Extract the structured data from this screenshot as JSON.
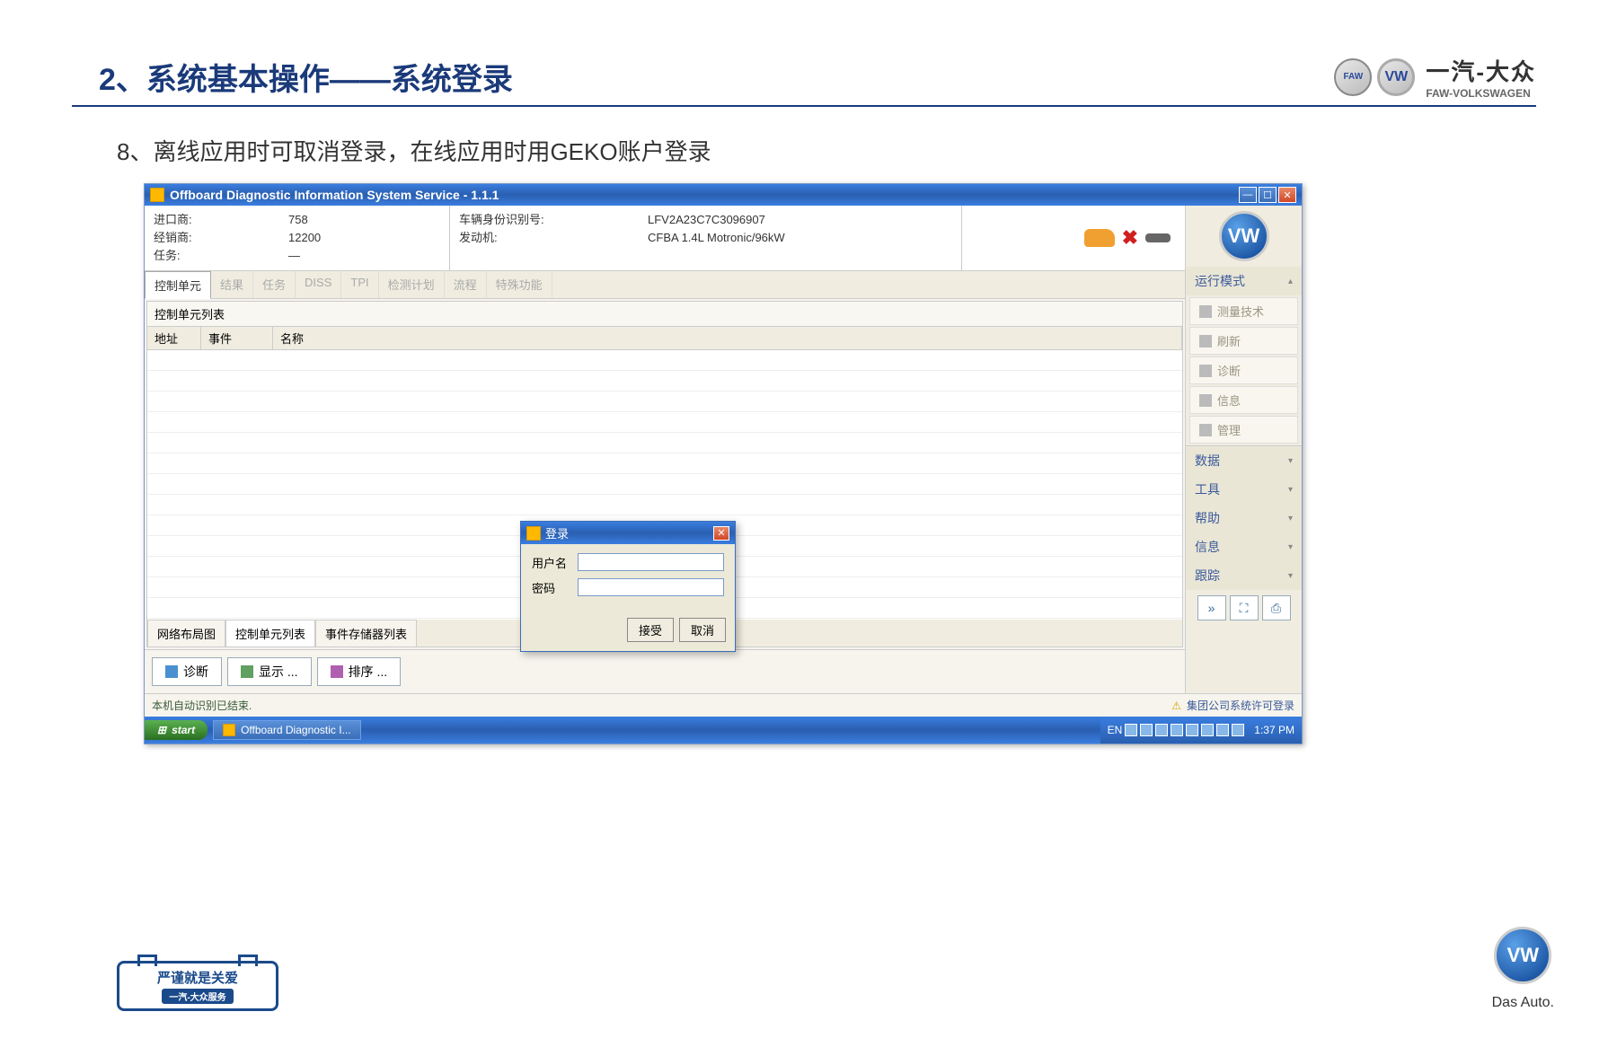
{
  "slide": {
    "title": "2、系统基本操作——系统登录",
    "subtitle": "8、离线应用时可取消登录，在线应用时用GEKO账户登录",
    "brand_cn": "一汽-大众",
    "brand_en": "FAW-VOLKSWAGEN"
  },
  "app": {
    "title": "Offboard Diagnostic Information System Service - 1.1.1",
    "info": {
      "importer_label": "进口商:",
      "importer_value": "758",
      "dealer_label": "经销商:",
      "dealer_value": "12200",
      "task_label": "任务:",
      "task_value": "—",
      "vin_label": "车辆身份识别号:",
      "vin_value": "LFV2A23C7C3096907",
      "engine_label": "发动机:",
      "engine_value": "CFBA 1.4L Motronic/96kW"
    },
    "tabs": [
      "控制单元",
      "结果",
      "任务",
      "DISS",
      "TPI",
      "检测计划",
      "流程",
      "特殊功能"
    ],
    "panel_title": "控制单元列表",
    "grid_headers": {
      "addr": "地址",
      "event": "事件",
      "name": "名称"
    },
    "subtabs": [
      "网络布局图",
      "控制单元列表",
      "事件存储器列表"
    ],
    "toolbar": {
      "diag": "诊断",
      "display": "显示 ...",
      "sort": "排序 ..."
    },
    "side": {
      "mode_title": "运行模式",
      "mode_items": [
        "测量技术",
        "刷新",
        "诊断",
        "信息",
        "管理"
      ],
      "sections": [
        "数据",
        "工具",
        "帮助",
        "信息",
        "跟踪"
      ]
    },
    "status_left": "本机自动识别已结束.",
    "status_right": "集团公司系统许可登录"
  },
  "login": {
    "title": "登录",
    "user_label": "用户名",
    "pwd_label": "密码",
    "accept": "接受",
    "cancel": "取消"
  },
  "taskbar": {
    "start": "start",
    "task": "Offboard Diagnostic I...",
    "lang": "EN",
    "time": "1:37 PM"
  },
  "footer": {
    "badge": "严谨就是关爱",
    "badge_sub": "一汽-大众服务",
    "das_auto": "Das Auto."
  }
}
